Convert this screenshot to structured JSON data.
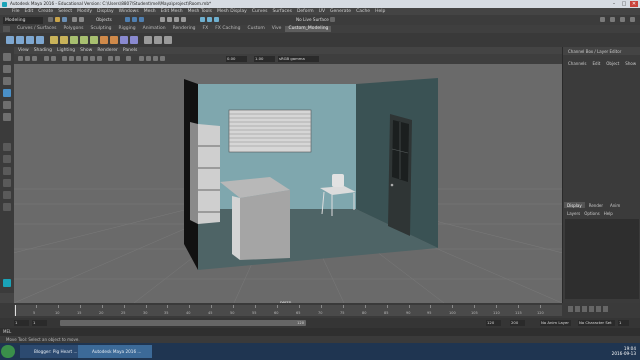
{
  "window": {
    "title": "Autodesk Maya 2016 - Educational Version: C:\\Users\\8807\\Student\\mel\\Maya\\project\\Room.mb*",
    "controls": [
      "–",
      "□",
      "✕"
    ]
  },
  "menubar": [
    "File",
    "Edit",
    "Create",
    "Select",
    "Modify",
    "Display",
    "Windows",
    "Mesh",
    "Edit Mesh",
    "Mesh Tools",
    "Mesh Display",
    "Curves",
    "Surfaces",
    "Deform",
    "UV",
    "Generate",
    "Cache",
    "Help"
  ],
  "statusline": {
    "mode": "Modeling",
    "objects_label": "Objects",
    "live_surface": "No Live Surface"
  },
  "shelf_tabs": {
    "items": [
      "Curves / Surfaces",
      "Polygons",
      "Sculpting",
      "Rigging",
      "Animation",
      "Rendering",
      "FX",
      "FX Caching",
      "Custom",
      "Vive",
      "Custom_Modeling"
    ],
    "active": "Custom_Modeling"
  },
  "panel_menu": [
    "View",
    "Shading",
    "Lighting",
    "Show",
    "Renderer",
    "Panels"
  ],
  "panel_toolbar": {
    "value1": "0.00",
    "value2": "1.00",
    "gamma": "sRGB gamma"
  },
  "viewport": {
    "camera_label": "persp"
  },
  "right_panel": {
    "header": "Channel Box / Layer Editor",
    "menu": [
      "Channels",
      "Edit",
      "Object",
      "Show"
    ],
    "tabs": [
      "Display",
      "Render",
      "Anim"
    ],
    "active_tab": "Display",
    "layers_menu": [
      "Layers",
      "Options",
      "Help"
    ]
  },
  "timeline": {
    "ticks": [
      "5",
      "10",
      "15",
      "20",
      "25",
      "30",
      "35",
      "40",
      "45",
      "50",
      "55",
      "60",
      "65",
      "70",
      "75",
      "80",
      "85",
      "90",
      "95",
      "100",
      "105",
      "110",
      "115",
      "120"
    ],
    "current_frame": "1"
  },
  "range": {
    "start": "1",
    "playback_start": "1",
    "range_label": "120",
    "playback_end": "120",
    "end": "200",
    "anim_layer": "No Anim Layer",
    "char_set": "No Character Set",
    "frame_field": "1"
  },
  "command_line": {
    "mode": "MEL"
  },
  "help_line": "Move Tool: Select an object to move.",
  "taskbar": {
    "items": [
      "Blogger: Pig Heart ...",
      "Autodesk Maya 2016 ..."
    ],
    "active": "Autodesk Maya 2016 ...",
    "time": "19:04",
    "date": "2016-09-13"
  },
  "colors": {
    "viewport_bg": "#6a6a6a",
    "wall_back": "#7fa7ae",
    "wall_right": "#3a5254",
    "floor": "#4e6466",
    "furniture": "#a9a9a9",
    "door": "#2f3535",
    "taskbar": "#1f3551"
  }
}
